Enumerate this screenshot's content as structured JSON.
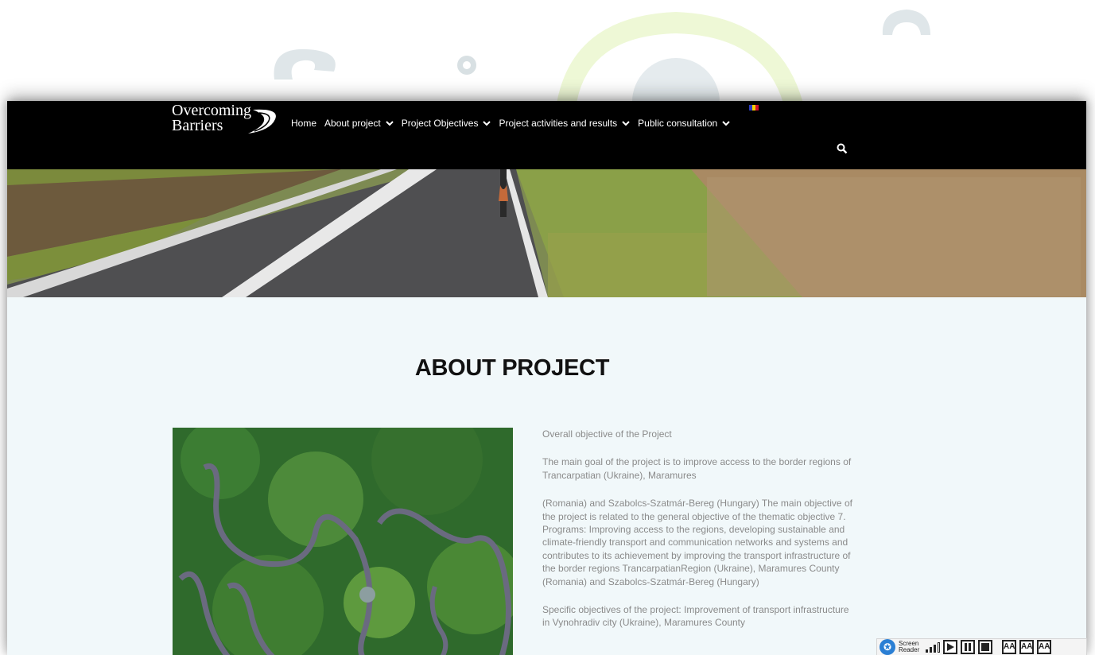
{
  "brand": {
    "logo_line1": "Overcoming",
    "logo_line2": "Barriers"
  },
  "nav": {
    "items": [
      {
        "label": "Home",
        "has_dropdown": false
      },
      {
        "label": "About project",
        "has_dropdown": true
      },
      {
        "label": "Project Objectives",
        "has_dropdown": true
      },
      {
        "label": "Project activities and results",
        "has_dropdown": true
      },
      {
        "label": "Public consultation",
        "has_dropdown": true
      }
    ],
    "language_flag": "romania-flag",
    "search_icon": "search-icon"
  },
  "hero": {
    "slides": 6,
    "active_slide": 4
  },
  "section": {
    "title": "ABOUT PROJECT",
    "paragraphs": [
      "Overall objective of the Project",
      "The main goal of the project is to improve access to the border regions of Trancarpatian (Ukraine), Maramures",
      "(Romania) and Szabolcs-Szatmár-Bereg (Hungary) The main objective of the project is related to the general objective of the thematic objective 7. Programs: Improving access to the regions, developing sustainable and climate-friendly transport and communication networks and systems and contributes to its achievement by improving the transport infrastructure of the border regions TrancarpatianRegion (Ukraine), Maramures County (Romania) and Szabolcs-Szatmár-Bereg (Hungary)",
      "Specific objectives of the project: Improvement of transport infrastructure in Vynohradiv city (Ukraine), Maramures County"
    ]
  },
  "screen_reader": {
    "label_line1": "Screen",
    "label_line2": "Reader",
    "font_buttons": [
      "AA",
      "AA",
      "AA"
    ]
  },
  "colors": {
    "nav_bg": "#000000",
    "page_bg": "#f1f8fa",
    "text_grey": "#8a8a8a"
  }
}
